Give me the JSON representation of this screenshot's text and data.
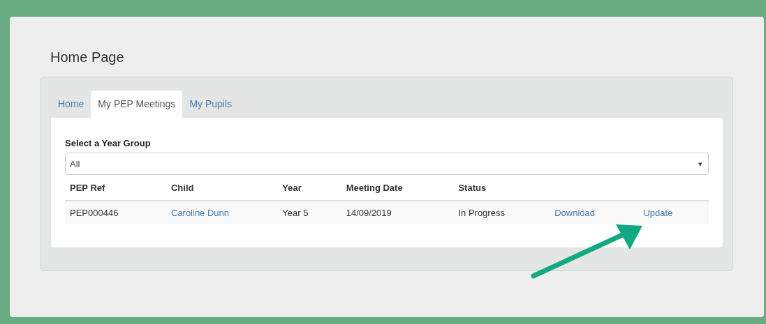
{
  "page": {
    "title": "Home Page"
  },
  "tabs": [
    {
      "label": "Home",
      "selected": false
    },
    {
      "label": "My PEP Meetings",
      "selected": true
    },
    {
      "label": "My Pupils",
      "selected": false
    }
  ],
  "filter": {
    "label": "Select a Year Group",
    "value": "All",
    "caret": "▾"
  },
  "table": {
    "columns": [
      "PEP Ref",
      "Child",
      "Year",
      "Meeting Date",
      "Status",
      "",
      ""
    ],
    "rows": [
      {
        "cells": [
          {
            "kind": "text",
            "text": "PEP000446"
          },
          {
            "kind": "link",
            "text": "Caroline Dunn"
          },
          {
            "kind": "text",
            "text": "Year 5"
          },
          {
            "kind": "text",
            "text": "14/09/2019"
          },
          {
            "kind": "text",
            "text": "In Progress"
          },
          {
            "kind": "link",
            "text": "Download"
          },
          {
            "kind": "link",
            "text": "Update"
          }
        ]
      }
    ]
  }
}
